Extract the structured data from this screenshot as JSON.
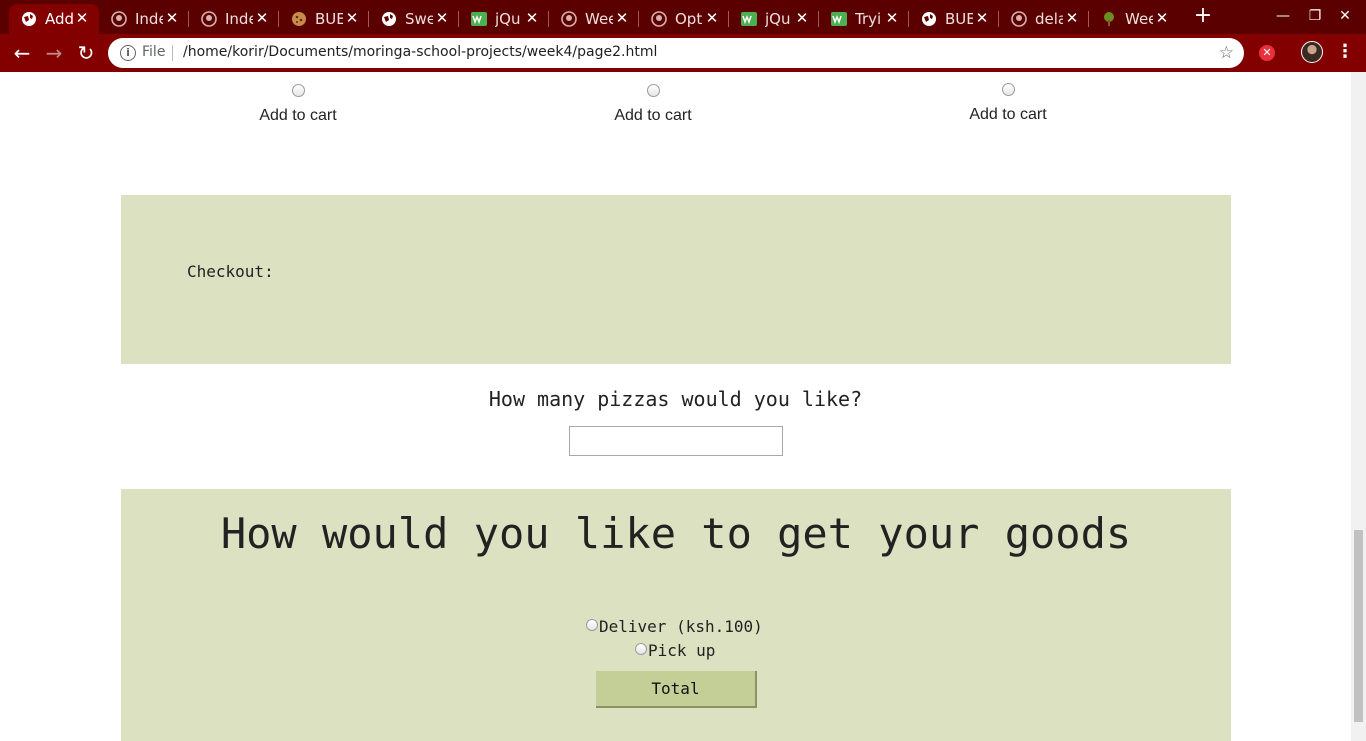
{
  "browser": {
    "tabs": [
      {
        "title": "Add",
        "icon": "globe-icon",
        "active": true
      },
      {
        "title": "Inde",
        "icon": "github-icon"
      },
      {
        "title": "Inde",
        "icon": "github-icon"
      },
      {
        "title": "BUE",
        "icon": "cookie-icon"
      },
      {
        "title": "Swe",
        "icon": "globe-icon"
      },
      {
        "title": "jQu",
        "icon": "w3schools-icon"
      },
      {
        "title": "Wee",
        "icon": "github-icon"
      },
      {
        "title": "Opt",
        "icon": "github-icon"
      },
      {
        "title": "jQu",
        "icon": "w3schools-icon"
      },
      {
        "title": "Tryi",
        "icon": "w3schools-icon"
      },
      {
        "title": "BUE",
        "icon": "globe-icon"
      },
      {
        "title": "dela",
        "icon": "github-icon"
      },
      {
        "title": "Wee",
        "icon": "tree-icon"
      }
    ],
    "address_scheme": "File",
    "address_url": "/home/korir/Documents/moringa-school-projects/week4/page2.html",
    "colors": {
      "frame": "#5b0000",
      "toolbar": "#820000"
    }
  },
  "page": {
    "cart_items": [
      {
        "label": "Add to cart"
      },
      {
        "label": "Add to cart"
      },
      {
        "label": "Add to cart"
      }
    ],
    "checkout_label": "Checkout:",
    "quantity_question": "How many pizzas would you like?",
    "quantity_value": "",
    "delivery_title": "How would you like to get your goods",
    "delivery_options": [
      {
        "label": "Deliver (ksh.100)"
      },
      {
        "label": "Pick up"
      }
    ],
    "total_button": "Total",
    "colors": {
      "panel": "#dce2c1",
      "button": "#c4cf97"
    }
  }
}
